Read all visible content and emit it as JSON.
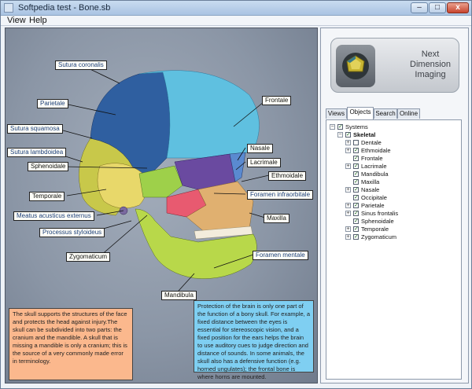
{
  "window": {
    "title": "Softpedia test - Bone.sb"
  },
  "menu": {
    "view": "View",
    "help": "Help"
  },
  "window_controls": {
    "minimize": "–",
    "maximize": "□",
    "close": "x"
  },
  "labels": {
    "sutura_coronalis": "Sutura coronalis",
    "parietale": "Parietale",
    "frontale": "Frontale",
    "sutura_squamosa": "Sutura squamosa",
    "sutura_lambdoidea": "Sutura lambdoidea",
    "nasale": "Nasale",
    "lacrimale": "Lacrimale",
    "sphenoidale": "Sphenoidale",
    "ethmoidale": "Ethmoidale",
    "foramen_infraorbitale": "Foramen infraorbitale",
    "temporale": "Temporale",
    "meatus": "Meatus acusticus externus",
    "maxilla": "Maxilla",
    "processus": "Processus styloideus",
    "zygomaticum": "Zygomaticum",
    "foramen_mentale": "Foramen mentale",
    "mandibula": "Mandibula"
  },
  "info_left": "The skull supports the structures of the face and protects the head against injury.The skull can be subdivided into two parts: the cranium and the mandible. A skull that is missing a mandible is only a cranium; this is the source of a very commonly made error in terminology.",
  "info_right": "Protection of the brain is only one part of the function of a bony skull. For example, a fixed distance between the eyes is essential for stereoscopic vision, and a fixed position for the ears helps the brain to use auditory cues to judge direction and distance of sounds. In some animals, the skull also has a defensive function (e.g. horned ungulates); the frontal bone is where horns are mounted.",
  "logo": {
    "line1": "Next",
    "line2": "Dimension",
    "line3": "Imaging"
  },
  "tabs": [
    "Views",
    "Objects",
    "Search",
    "Online"
  ],
  "tree": {
    "systems": "Systems",
    "skeletal": "Skeletal",
    "items": [
      "Dentale",
      "Ethmoidale",
      "Frontale",
      "Lacrimale",
      "Mandibula",
      "Maxilla",
      "Nasale",
      "Occipitale",
      "Parietale",
      "Sinus frontalis",
      "Sphenoidale",
      "Temporale",
      "Zygomaticum"
    ]
  },
  "colors": {
    "frontale": "#5fc0e0",
    "parietale": "#2f5fa0",
    "occipitale": "#c8c84a",
    "temporale": "#e8d86a",
    "sphenoidale": "#9ed04a",
    "maxilla": "#e0b070",
    "mandibula": "#b8d84a",
    "zygomaticum": "#e85a70",
    "info_left_bg": "#fbb88d",
    "info_right_bg": "#7fcff2"
  }
}
